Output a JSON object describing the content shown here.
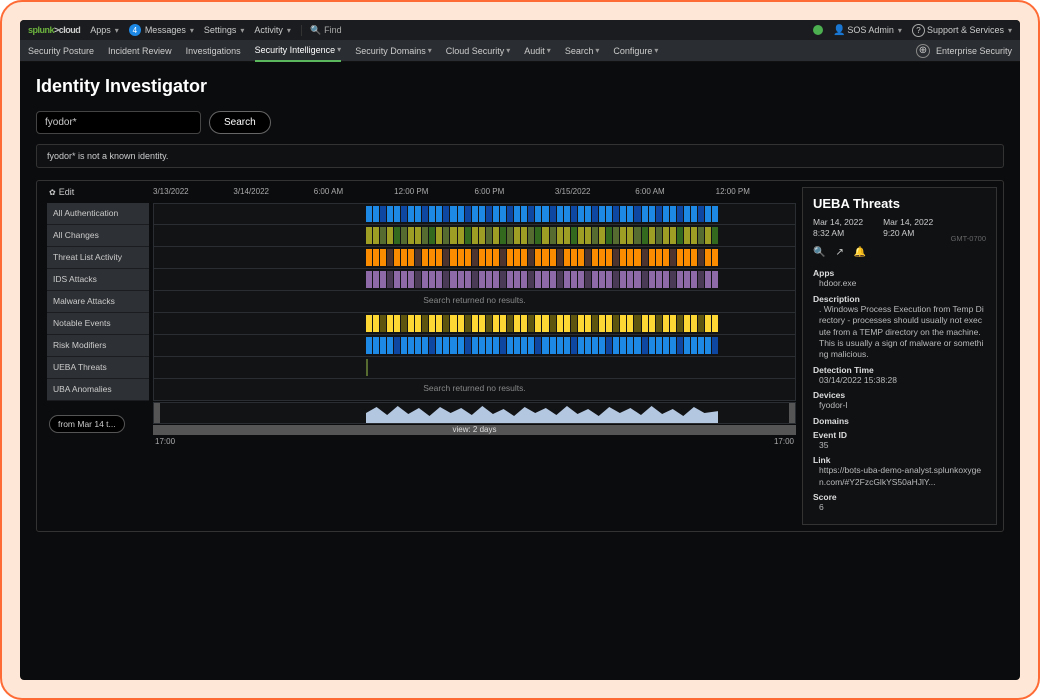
{
  "topbar": {
    "logo_a": "splunk",
    "logo_b": ">cloud",
    "apps": "Apps",
    "msg_count": "4",
    "messages": "Messages",
    "settings": "Settings",
    "activity": "Activity",
    "find": "Find",
    "user": "SOS Admin",
    "support": "Support & Services"
  },
  "nav": {
    "items": [
      "Security Posture",
      "Incident Review",
      "Investigations",
      "Security Intelligence",
      "Security Domains",
      "Cloud Security",
      "Audit",
      "Search",
      "Configure"
    ],
    "active_index": 3,
    "right": "Enterprise Security"
  },
  "page": {
    "title": "Identity Investigator",
    "search_value": "fyodor*",
    "search_btn": "Search",
    "banner": "fyodor* is not a known identity."
  },
  "swim": {
    "edit": "Edit",
    "time_ticks": [
      "3/13/2022",
      "3/14/2022",
      "6:00 AM",
      "12:00 PM",
      "6:00 PM",
      "3/15/2022",
      "6:00 AM",
      "12:00 PM"
    ],
    "lanes": [
      {
        "label": "All Authentication",
        "style": "c-blue"
      },
      {
        "label": "All Changes",
        "style": "c-green"
      },
      {
        "label": "Threat List Activity",
        "style": "c-orange"
      },
      {
        "label": "IDS Attacks",
        "style": "c-purple"
      },
      {
        "label": "Malware Attacks",
        "no_results": true
      },
      {
        "label": "Notable Events",
        "style": "c-yellow"
      },
      {
        "label": "Risk Modifiers",
        "style": "c-blue2"
      },
      {
        "label": "UEBA Threats",
        "tick": true
      },
      {
        "label": "UBA Anomalies",
        "no_results": true
      }
    ],
    "no_results_text": "Search returned no results.",
    "chip": "from Mar 14 t...",
    "view_label": "view: 2 days",
    "overview_start": "17:00",
    "overview_end": "17:00"
  },
  "detail": {
    "title": "UEBA Threats",
    "t1_date": "Mar 14, 2022",
    "t1_time": "8:32 AM",
    "t2_date": "Mar 14, 2022",
    "t2_time": "9:20 AM",
    "tz": "GMT-0700",
    "fields": [
      {
        "k": "Apps",
        "v": "hdoor.exe"
      },
      {
        "k": "Description",
        "v": ". Windows Process Execution from Temp Directory - processes should usually not execute from a TEMP directory on the machine. This is usually a sign of malware or something malicious."
      },
      {
        "k": "Detection Time",
        "v": "03/14/2022 15:38:28"
      },
      {
        "k": "Devices",
        "v": "fyodor-l"
      },
      {
        "k": "Domains",
        "v": ""
      },
      {
        "k": "Event ID",
        "v": "35"
      },
      {
        "k": "Link",
        "v": "https://bots-uba-demo-analyst.splunkoxygen.com/#Y2FzcGlkYS50aHJlY..."
      },
      {
        "k": "Score",
        "v": "6"
      }
    ]
  }
}
